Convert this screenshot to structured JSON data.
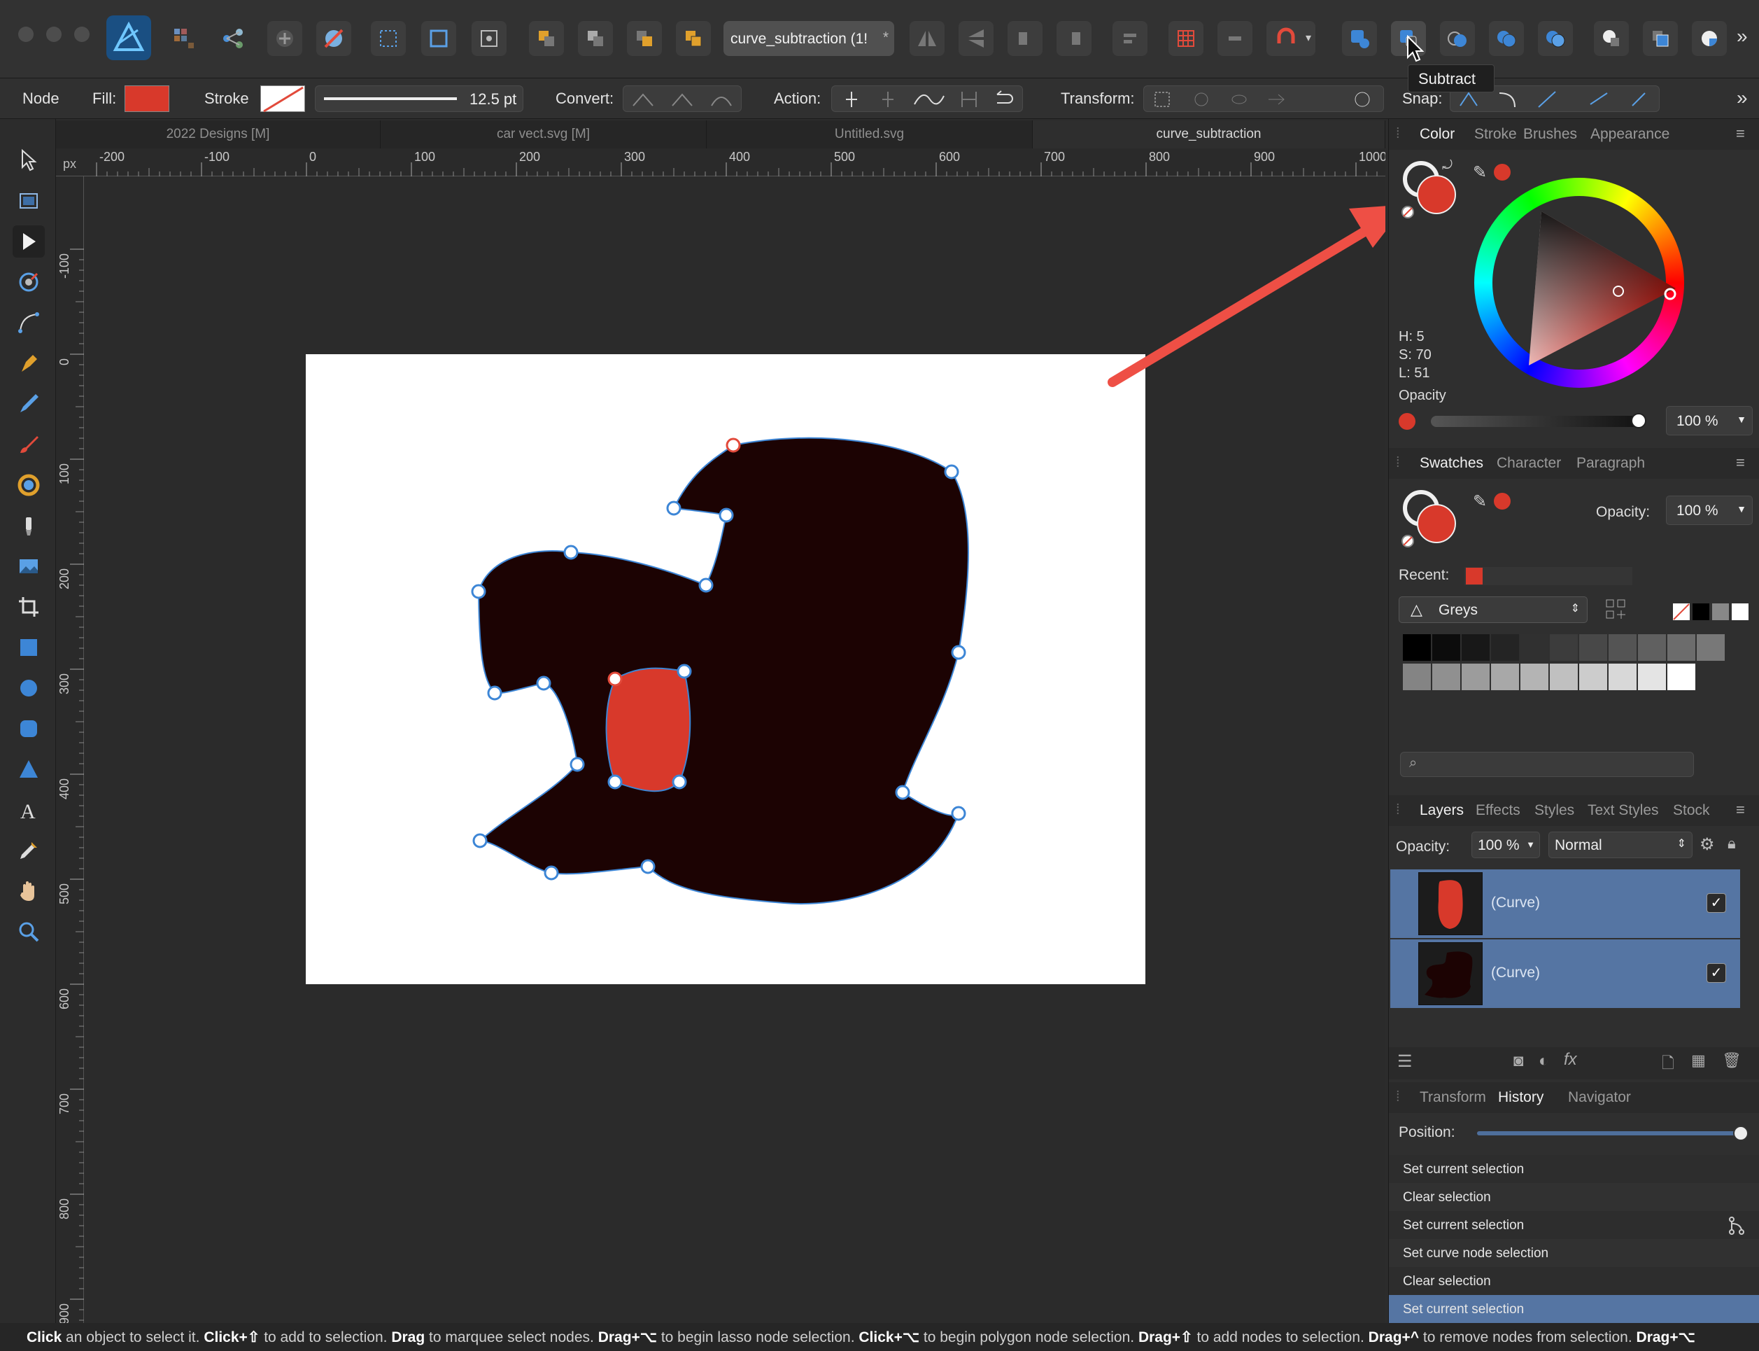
{
  "toolbar": {
    "doc_tab_title": "curve_subtraction (1!",
    "tooltip": "Subtract"
  },
  "context": {
    "mode": "Node",
    "fill_label": "Fill:",
    "stroke_label": "Stroke",
    "stroke_width": "12.5 pt",
    "convert_label": "Convert:",
    "action_label": "Action:",
    "transform_label": "Transform:",
    "snap_label": "Snap:"
  },
  "doc_tabs": [
    "2022 Designs [M]",
    "car vect.svg [M]",
    "Untitled.svg",
    "curve_subtraction"
  ],
  "ruler": {
    "unit": "px",
    "h_labels": [
      "-200",
      "-100",
      "0",
      "100",
      "200",
      "300",
      "400",
      "500",
      "600",
      "700",
      "800",
      "900",
      "1000"
    ],
    "v_labels": [
      "-100",
      "0",
      "100",
      "200",
      "300",
      "400",
      "500",
      "600",
      "700",
      "800",
      "900"
    ]
  },
  "color_panel": {
    "tabs": [
      "Color",
      "Stroke",
      "Brushes",
      "Appearance"
    ],
    "h": "H: 5",
    "s": "S: 70",
    "l": "L: 51",
    "opacity_label": "Opacity",
    "opacity_value": "100 %",
    "color": "#d8392b"
  },
  "swatches_panel": {
    "tabs": [
      "Swatches",
      "Character",
      "Paragraph"
    ],
    "opacity_label": "Opacity:",
    "opacity_value": "100 %",
    "recent_label": "Recent:",
    "palette": "Greys"
  },
  "layers_panel": {
    "tabs": [
      "Layers",
      "Effects",
      "Styles",
      "Text Styles",
      "Stock"
    ],
    "opacity_label": "Opacity:",
    "opacity_value": "100 %",
    "blend": "Normal",
    "layers": [
      {
        "name": "(Curve)",
        "visible": true
      },
      {
        "name": "(Curve)",
        "visible": true
      }
    ]
  },
  "history_panel": {
    "tabs": [
      "Transform",
      "History",
      "Navigator"
    ],
    "position_label": "Position:",
    "items": [
      "Set current selection",
      "Clear selection",
      "Set current selection",
      "Set curve node selection",
      "Clear selection",
      "Set current selection"
    ]
  },
  "status": {
    "segments": [
      {
        "b": "Click",
        "t": " an object to select it. "
      },
      {
        "b": "Click+⇧",
        "t": " to add to selection. "
      },
      {
        "b": "Drag",
        "t": " to marquee select nodes. "
      },
      {
        "b": "Drag+⌥",
        "t": " to begin lasso node selection. "
      },
      {
        "b": "Click+⌥",
        "t": " to begin polygon node selection. "
      },
      {
        "b": "Drag+⇧",
        "t": " to add nodes to selection. "
      },
      {
        "b": "Drag+^",
        "t": " to remove nodes from selection. "
      },
      {
        "b": "Drag+⌥",
        "t": ""
      }
    ]
  },
  "colors": {
    "accent_red": "#d8392b",
    "shape_dark": "#1c0303",
    "selection_blue": "#5575a3",
    "node_blue": "#3d86d6"
  }
}
